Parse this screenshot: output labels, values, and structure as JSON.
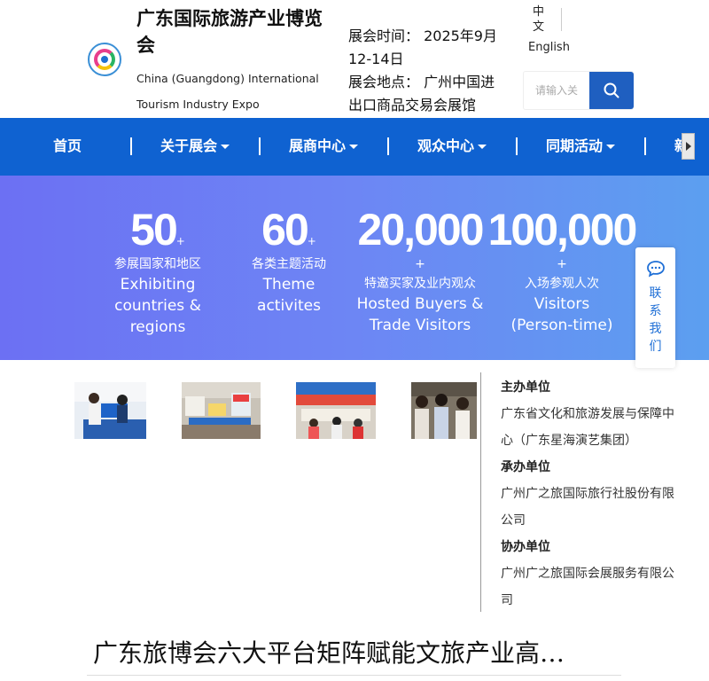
{
  "header": {
    "title": "广东国际旅游产业博览会",
    "title_en": "China (Guangdong) International Tourism Industry Expo",
    "expo_time": "展会时间：  2025年9月12-14日",
    "expo_venue": "展会地点：  广州中国进出口商品交易会展馆",
    "lang_zh": "中文",
    "lang_en": "English",
    "search_placeholder": "请输入关",
    "search_icon": "search-icon",
    "brand_color": "#0f62d1"
  },
  "nav": {
    "items": [
      {
        "label": "首页",
        "dropdown": false
      },
      {
        "label": "关于展会",
        "dropdown": true
      },
      {
        "label": "展商中心",
        "dropdown": true
      },
      {
        "label": "观众中心",
        "dropdown": true
      },
      {
        "label": "同期活动",
        "dropdown": true
      },
      {
        "label": "新",
        "dropdown": false
      }
    ],
    "separator": "|"
  },
  "stats": [
    {
      "number": "50",
      "plus": "+",
      "label_zh": "参展国家和地区",
      "label_en": "Exhibiting countries & regions"
    },
    {
      "number": "60",
      "plus": "+",
      "label_zh": "各类主题活动",
      "label_en": "Theme activites"
    },
    {
      "number": "20,000",
      "plus": "+",
      "label_zh": "特邀买家及业内观众",
      "label_en": "Hosted Buyers & Trade Visitors"
    },
    {
      "number": "100,000",
      "plus": "+",
      "label_zh": "入场参观人次",
      "label_en": "Visitors (Person-time)"
    }
  ],
  "contact": {
    "label": "联系我们",
    "icon": "chat-bubble-icon"
  },
  "organizers": [
    {
      "heading": "主办单位",
      "value": "广东省文化和旅游发展与保障中心（广东星海演艺集团）"
    },
    {
      "heading": "承办单位",
      "value": "广州广之旅国际旅行社股份有限公司"
    },
    {
      "heading": "协办单位",
      "value": "广州广之旅国际会展服务有限公司"
    }
  ],
  "headline": "广东旅博会六大平台矩阵赋能文旅产业高…"
}
